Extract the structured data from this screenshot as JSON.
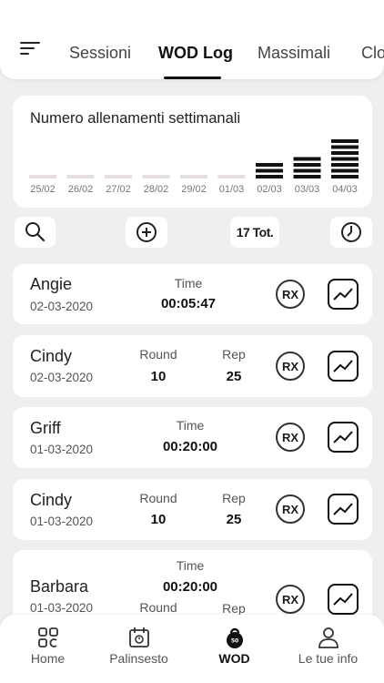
{
  "tabs": [
    {
      "label": "Sessioni"
    },
    {
      "label": "WOD Log"
    },
    {
      "label": "Massimali"
    },
    {
      "label": "Clo"
    }
  ],
  "chart": {
    "title": "Numero allenamenti settimanali"
  },
  "chart_data": {
    "type": "bar",
    "title": "Numero allenamenti settimanali",
    "categories": [
      "25/02",
      "26/02",
      "27/02",
      "28/02",
      "29/02",
      "01/03",
      "02/03",
      "03/03",
      "04/03"
    ],
    "values": [
      0,
      0,
      0,
      0,
      0,
      0,
      3,
      4,
      7
    ],
    "bar_color": "#111111",
    "empty_color": "#e6dfe2"
  },
  "toolbar": {
    "total_label": "17 Tot."
  },
  "workouts": [
    {
      "name": "Angie",
      "date": "02-03-2020",
      "label1": "Time",
      "value1": "00:05:47",
      "rx": "RX"
    },
    {
      "name": "Cindy",
      "date": "02-03-2020",
      "label1": "Round",
      "value1": "10",
      "label2": "Rep",
      "value2": "25",
      "rx": "RX"
    },
    {
      "name": "Griff",
      "date": "01-03-2020",
      "label1": "Time",
      "value1": "00:20:00",
      "rx": "RX"
    },
    {
      "name": "Cindy",
      "date": "01-03-2020",
      "label1": "Round",
      "value1": "10",
      "label2": "Rep",
      "value2": "25",
      "rx": "RX"
    },
    {
      "name": "Barbara",
      "date": "01-03-2020",
      "label1": "Time",
      "value1": "00:20:00",
      "label2": "Round",
      "label3": "Rep",
      "rx": "RX"
    }
  ],
  "nav": [
    {
      "label": "Home",
      "icon": "grid-icon"
    },
    {
      "label": "Palinsesto",
      "icon": "calendar-icon"
    },
    {
      "label": "WOD",
      "icon": "kettlebell-icon",
      "badge": "50"
    },
    {
      "label": "Le tue info",
      "icon": "user-icon"
    }
  ]
}
